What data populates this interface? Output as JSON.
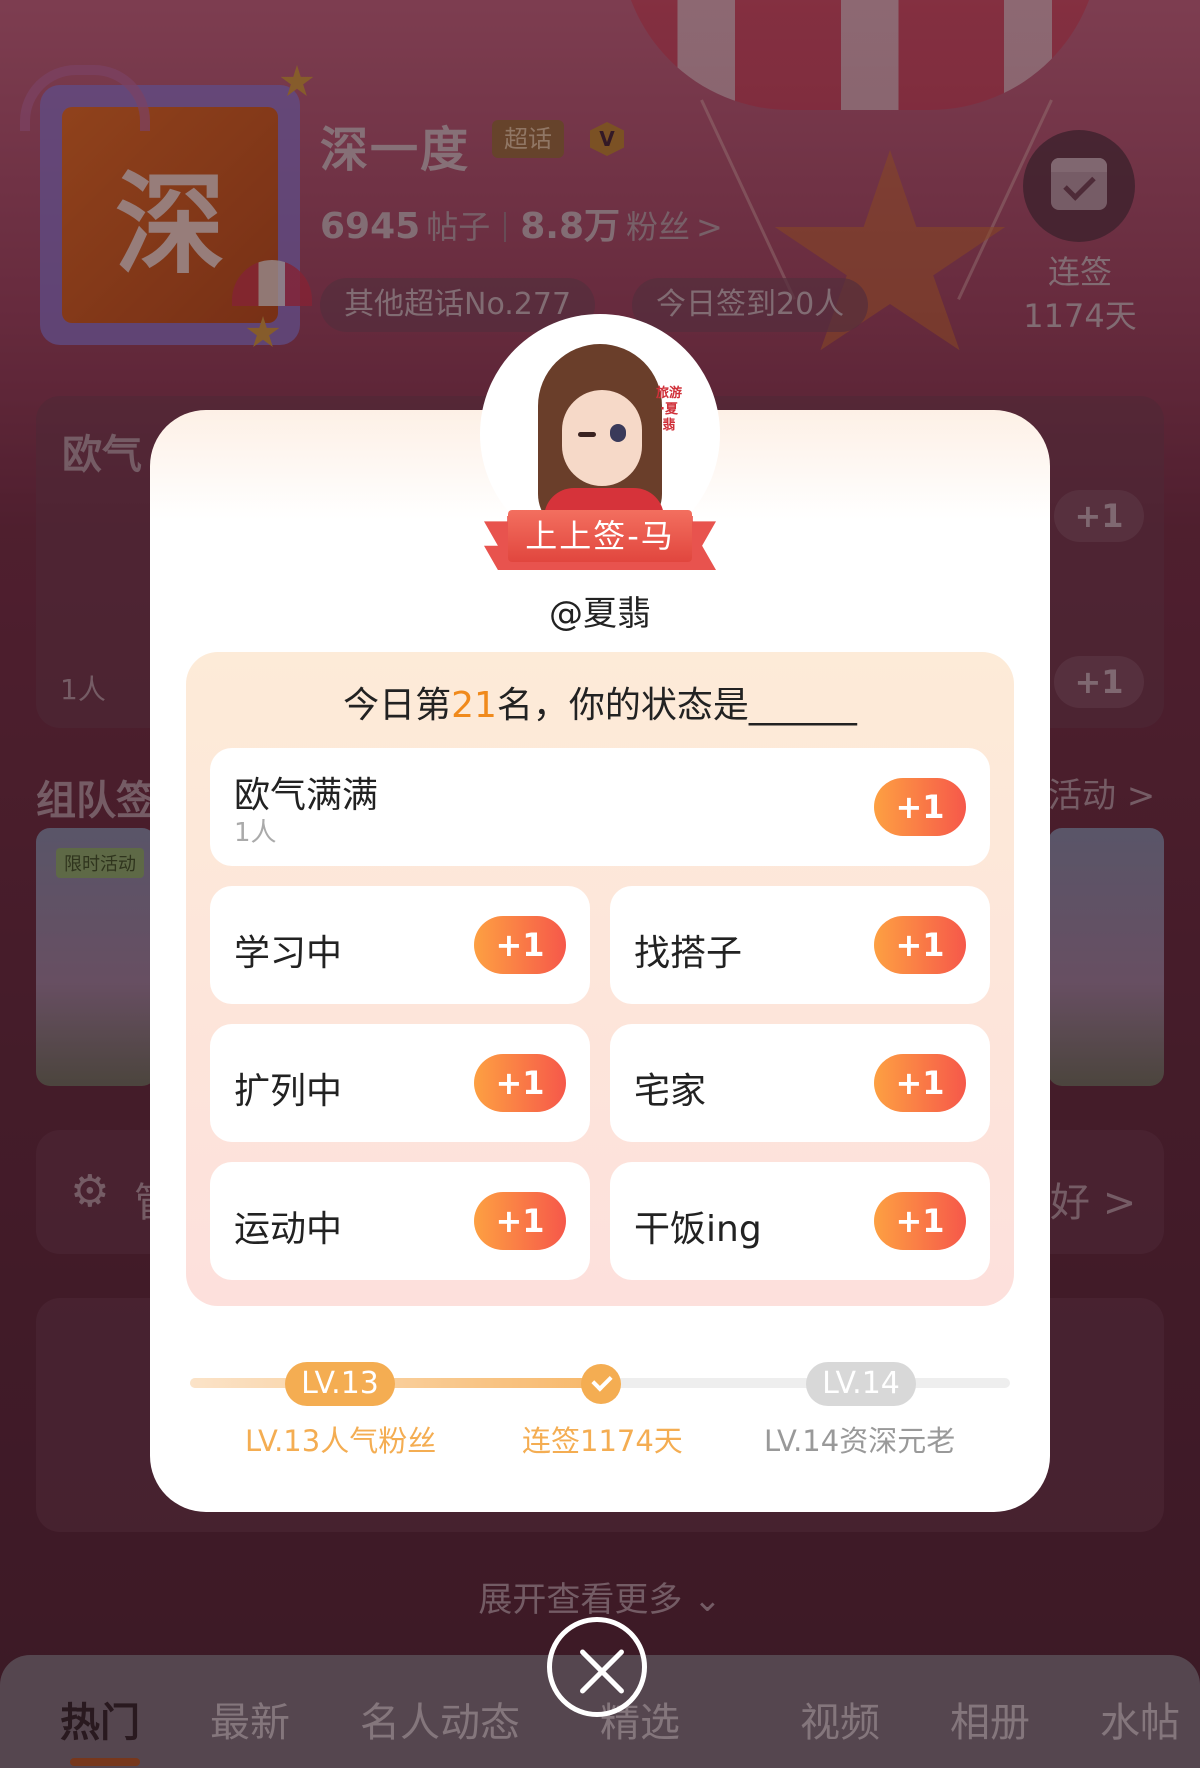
{
  "topic": {
    "cover_char": "深",
    "title": "深一度",
    "badge": "超话",
    "verified_mark": "V",
    "posts_count": "6945",
    "posts_label": "帖子",
    "fans_count": "8.8万",
    "fans_label": "粉丝",
    "fans_arrow": ">",
    "rank_chip": "其他超话No.277",
    "checkin_chip": "今日签到20人",
    "streak_label": "连签",
    "streak_days": "1174天"
  },
  "background": {
    "card1_title": "欧气",
    "card1_count": "1人",
    "plus": "+1",
    "team_section": "组队签",
    "activity_link": "活动 >",
    "limited_badge": "限时活动",
    "manage_label": "管",
    "pref_label": "好 >"
  },
  "modal": {
    "sign_result": "上上签-马",
    "username": "@夏翡",
    "avatar_caption": "旅游·夏翡",
    "status_prefix": "今日第",
    "status_rank": "21",
    "status_suffix": "名，你的状态是______",
    "options": [
      {
        "label": "欧气满满",
        "count": "1人",
        "plus": "+1"
      },
      {
        "label": "学习中",
        "plus": "+1"
      },
      {
        "label": "找搭子",
        "plus": "+1"
      },
      {
        "label": "扩列中",
        "plus": "+1"
      },
      {
        "label": "宅家",
        "plus": "+1"
      },
      {
        "label": "运动中",
        "plus": "+1"
      },
      {
        "label": "干饭ing",
        "plus": "+1"
      }
    ],
    "level": {
      "current_pill": "LV.13",
      "current_label": "LV.13人气粉丝",
      "streak_label": "连签1174天",
      "next_pill": "LV.14",
      "next_label": "LV.14资深元老"
    }
  },
  "expand_more": "展开查看更多 ⌄",
  "tabs": [
    "热门",
    "最新",
    "名人动态",
    "精选",
    "视频",
    "相册",
    "水帖"
  ],
  "colors": {
    "accent": "#f4ad52",
    "plus_start": "#fda042",
    "plus_end": "#f6584a",
    "rank": "#f08a1c"
  }
}
